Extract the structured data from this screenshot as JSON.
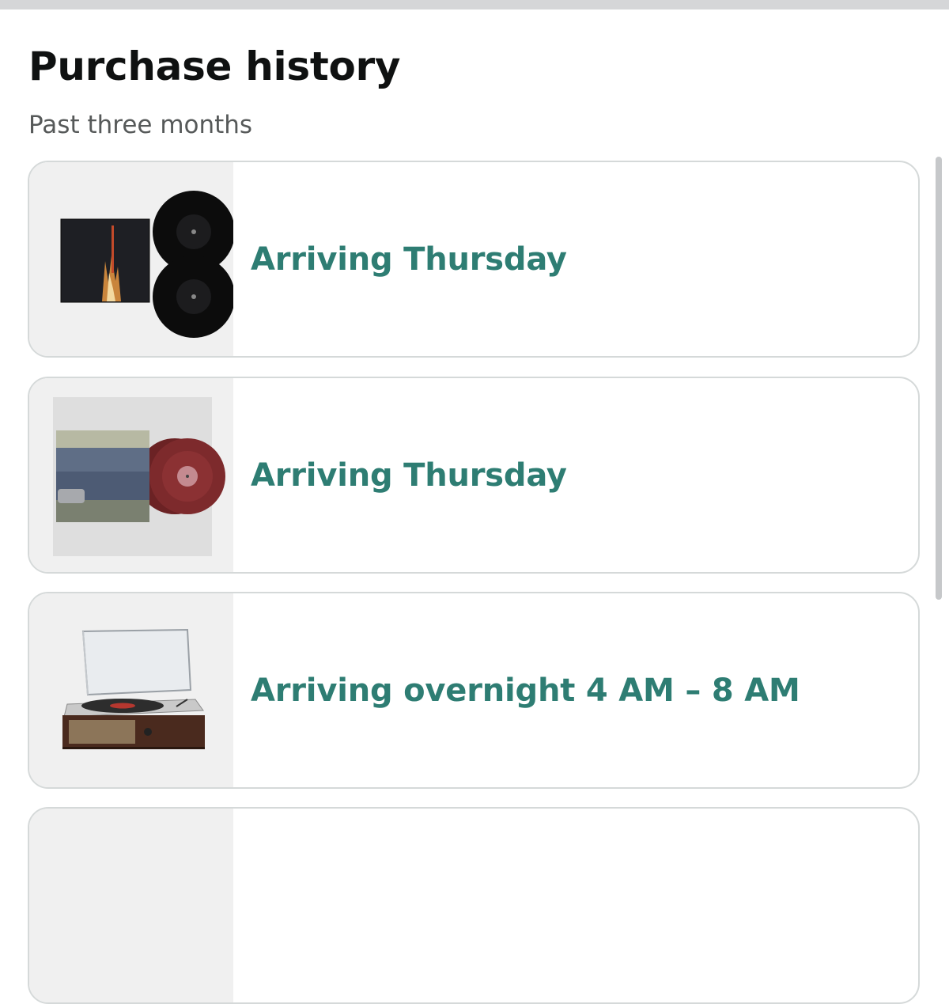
{
  "page": {
    "title": "Purchase history",
    "subtitle": "Past three months"
  },
  "orders": [
    {
      "status": "Arriving Thursday",
      "product_icon": "vinyl-album-black-double-lp"
    },
    {
      "status": "Arriving Thursday",
      "product_icon": "vinyl-album-red-marbled-lp"
    },
    {
      "status": "Arriving overnight 4 AM – 8 AM",
      "product_icon": "record-player-turntable"
    }
  ],
  "colors": {
    "status_text": "#2e7d73",
    "title_text": "#0f1111",
    "subtitle_text": "#565959",
    "card_border": "#d5d9d9",
    "thumb_background": "#f0f0f0"
  }
}
